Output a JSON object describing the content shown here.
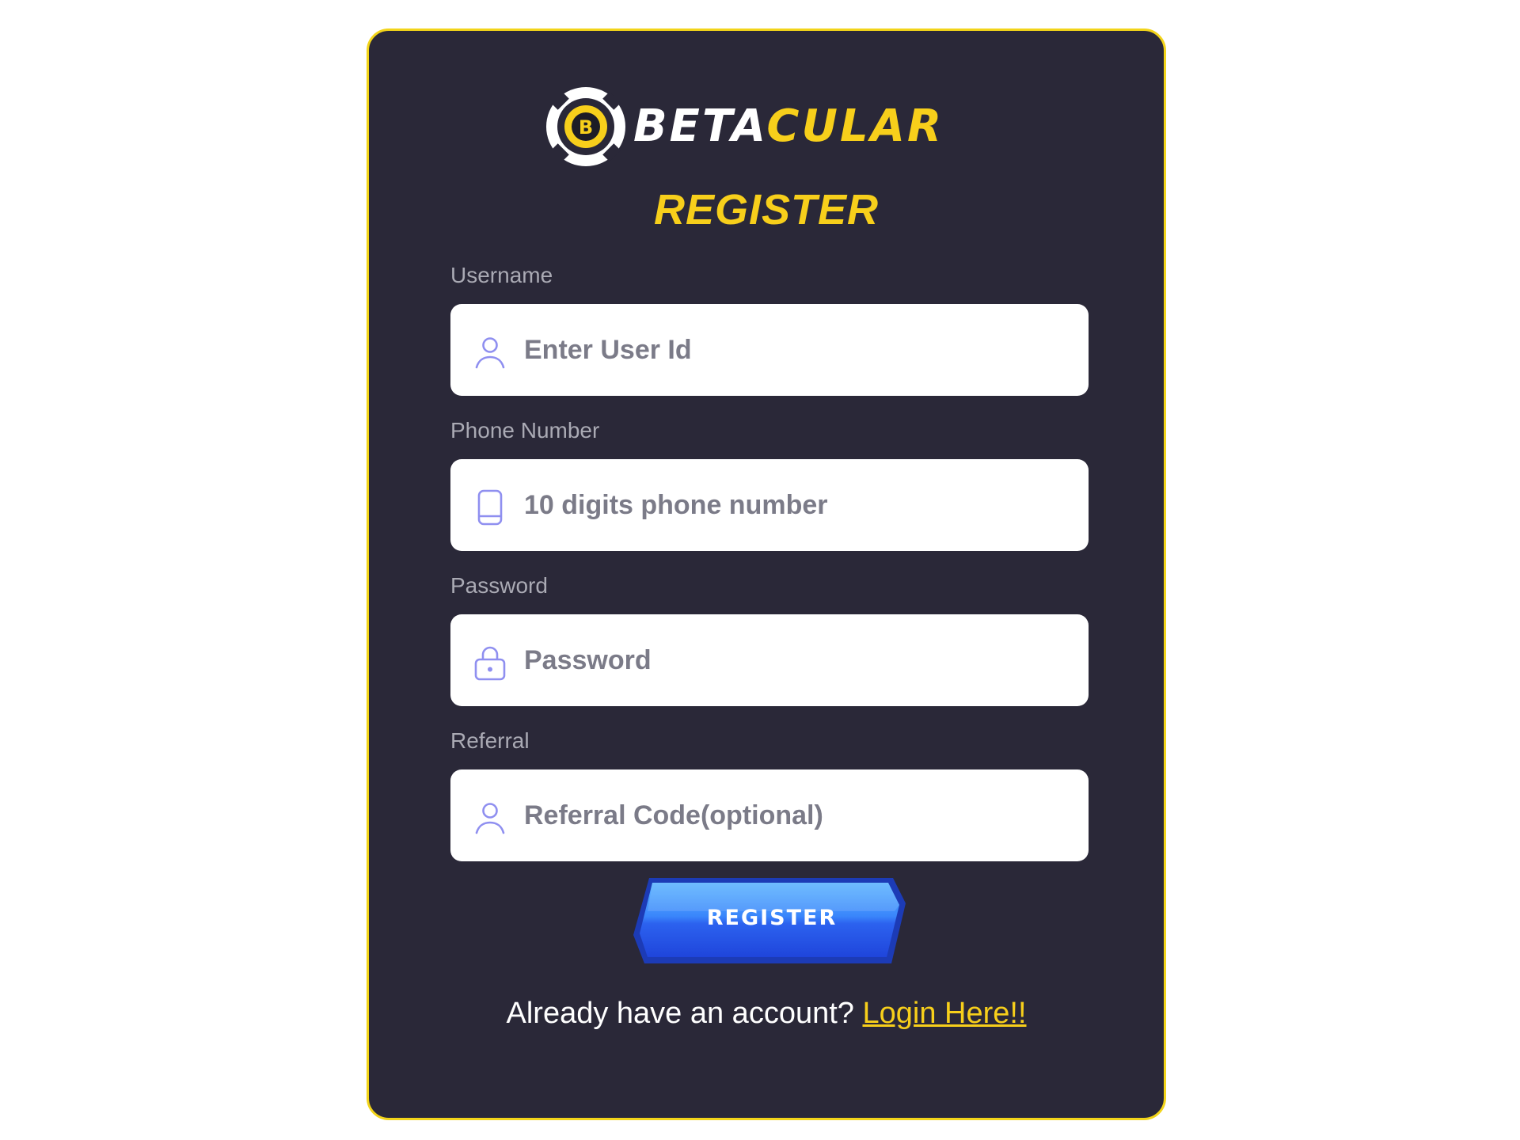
{
  "brand": {
    "name_part1": "BETA",
    "name_part2": "CULAR",
    "logo_letter": "B",
    "logo_icon": "casino-chip-icon",
    "colors": {
      "accent_yellow": "#f7cf1b",
      "card_background": "#2a2838",
      "button_blue": "#2d6ff2"
    }
  },
  "form": {
    "title": "REGISTER",
    "fields": {
      "username": {
        "label": "Username",
        "placeholder": "Enter User Id",
        "value": "",
        "icon": "user-icon"
      },
      "phone": {
        "label": "Phone Number",
        "placeholder": "10 digits phone number",
        "value": "",
        "icon": "phone-icon"
      },
      "password": {
        "label": "Password",
        "placeholder": "Password",
        "value": "",
        "icon": "lock-icon"
      },
      "referral": {
        "label": "Referral",
        "placeholder": "Referral Code(optional)",
        "value": "",
        "icon": "user-icon"
      }
    },
    "submit_label": "REGISTER",
    "footer_text": "Already have an account?",
    "login_link": "Login Here!!"
  }
}
